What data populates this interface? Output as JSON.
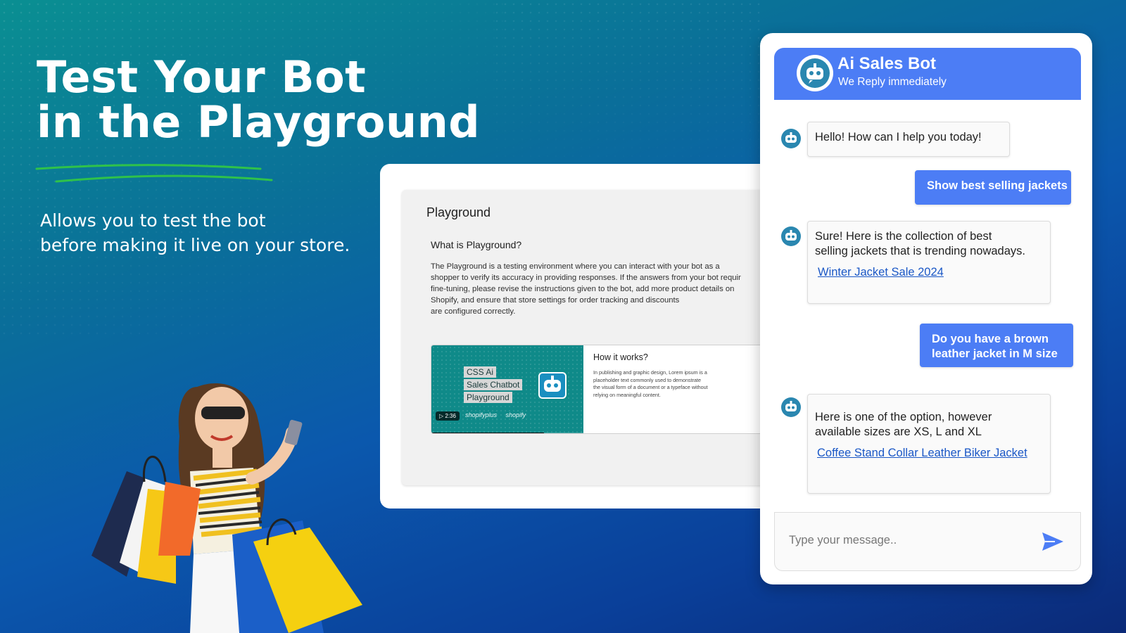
{
  "hero": {
    "title_line1": "Test Your Bot",
    "title_line2": "in the Playground",
    "subtitle_line1": "Allows you to test the bot",
    "subtitle_line2": "before making it live on your store."
  },
  "playground": {
    "title": "Playground",
    "question": "What is Playground?",
    "description_lines": [
      "The Playground is a testing environment where you can interact with your bot as a",
      "shopper to verify its accuracy in providing responses. If the answers from your bot requir",
      "fine-tuning, please revise the instructions given to the bot, add more product details on",
      "Shopify, and ensure that store settings for order tracking and discounts",
      "are configured correctly."
    ],
    "video": {
      "thumb_lines": [
        "CSS Ai",
        "Sales Chatbot",
        "Playground"
      ],
      "logo1": "shopifyplus",
      "logo2": "shopify",
      "duration": "▷ 2:36",
      "progress": 0.74
    },
    "how_title": "How it works?",
    "how_lines": [
      "In publishing and graphic design, Lorem ipsum is a",
      "placeholder text commonly used to demonstrate",
      "the visual form of a document or a typeface without",
      "relying on meaningful content."
    ]
  },
  "chat": {
    "title": "Ai Sales Bot",
    "subtitle": "We Reply immediately",
    "messages": [
      {
        "from": "bot",
        "lines": [
          "Hello! How can I help you today!"
        ]
      },
      {
        "from": "user",
        "lines": [
          "Show best selling jackets"
        ]
      },
      {
        "from": "bot",
        "lines": [
          "Sure! Here is the collection of best",
          "selling jackets that is trending nowadays."
        ],
        "link": "Winter Jacket Sale 2024"
      },
      {
        "from": "user",
        "lines": [
          "Do you have a brown",
          "leather jacket in M size"
        ]
      },
      {
        "from": "bot",
        "lines": [
          "Here is one of the option, however",
          "available sizes are XS, L and XL"
        ],
        "link": "Coffee Stand Collar Leather Biker Jacket"
      }
    ],
    "input_placeholder": "Type your message..",
    "accent": "#4c7df5"
  },
  "icons": {
    "bot_avatar": "robot-icon",
    "send": "send-icon"
  }
}
